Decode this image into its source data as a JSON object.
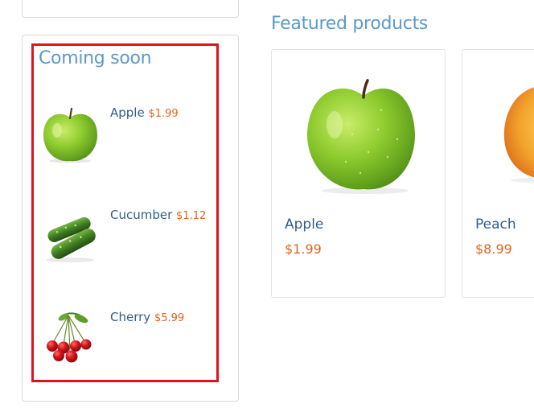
{
  "sidebar": {
    "coming_soon_title": "Coming soon",
    "items": [
      {
        "name": "Apple",
        "price": "$1.99",
        "image": "green-apple"
      },
      {
        "name": "Cucumber",
        "price": "$1.12",
        "image": "cucumbers"
      },
      {
        "name": "Cherry",
        "price": "$5.99",
        "image": "cherries"
      }
    ]
  },
  "featured": {
    "title": "Featured products",
    "products": [
      {
        "name": "Apple",
        "price": "$1.99",
        "image": "green-apple"
      },
      {
        "name": "Peach",
        "price": "$8.99",
        "image": "peach"
      }
    ]
  },
  "colors": {
    "heading": "#5b9bc9",
    "product_name": "#2e5e8e",
    "price": "#e0651c",
    "highlight_border": "#e0121c"
  }
}
